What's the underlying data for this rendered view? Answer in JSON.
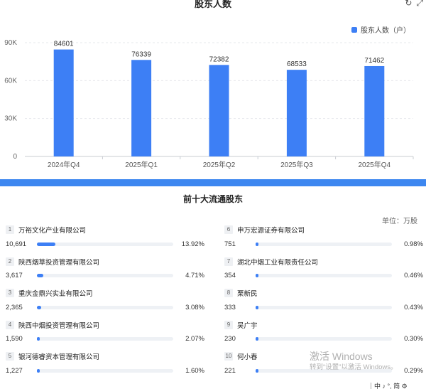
{
  "chart": {
    "title": "股东人数",
    "refresh_icon": "refresh-icon",
    "expand_icon": "expand-icon",
    "legend_label": "股东人数（户）",
    "accent": "#3d7ff5"
  },
  "chart_data": {
    "type": "bar",
    "title": "股东人数",
    "categories": [
      "2024年Q4",
      "2025年Q1",
      "2025年Q2",
      "2025年Q3",
      "2025年Q4"
    ],
    "series": [
      {
        "name": "股东人数（户）",
        "values": [
          84601,
          76339,
          72382,
          68533,
          71462
        ]
      }
    ],
    "ylim": [
      0,
      90000
    ],
    "yticks": [
      "0",
      "30K",
      "60K",
      "90K"
    ],
    "data_labels": [
      "84601",
      "76339",
      "72382",
      "68533",
      "71462"
    ],
    "grid": true,
    "legend": "top-right"
  },
  "holders": {
    "title": "前十大流通股东",
    "unit": "单位：万股",
    "bar_color": "#3d7ff5",
    "items": [
      {
        "rank": "1",
        "name": "万裕文化产业有限公司",
        "shares": "10,691",
        "pct": "13.92%",
        "ratio": 0.1392
      },
      {
        "rank": "2",
        "name": "陕西烟草投资管理有限公司",
        "shares": "3,617",
        "pct": "4.71%",
        "ratio": 0.0471
      },
      {
        "rank": "3",
        "name": "重庆金鼎兴实业有限公司",
        "shares": "2,365",
        "pct": "3.08%",
        "ratio": 0.0308
      },
      {
        "rank": "4",
        "name": "陕西中烟投资管理有限公司",
        "shares": "1,590",
        "pct": "2.07%",
        "ratio": 0.0207
      },
      {
        "rank": "5",
        "name": "银河德睿资本管理有限公司",
        "shares": "1,227",
        "pct": "1.60%",
        "ratio": 0.016
      },
      {
        "rank": "6",
        "name": "申万宏源证券有限公司",
        "shares": "751",
        "pct": "0.98%",
        "ratio": 0.0098
      },
      {
        "rank": "7",
        "name": "湖北中烟工业有限责任公司",
        "shares": "354",
        "pct": "0.46%",
        "ratio": 0.0046
      },
      {
        "rank": "8",
        "name": "栗新民",
        "shares": "333",
        "pct": "0.43%",
        "ratio": 0.0043
      },
      {
        "rank": "9",
        "name": "吴广宇",
        "shares": "230",
        "pct": "0.30%",
        "ratio": 0.003
      },
      {
        "rank": "10",
        "name": "何小春",
        "shares": "221",
        "pct": "0.29%",
        "ratio": 0.0029
      }
    ]
  },
  "watermark": {
    "line1": "激活 Windows",
    "line2": "转到“设置”以激活 Windows。"
  },
  "tray": {
    "text": "中 ♪ °, 简 ⚙"
  }
}
